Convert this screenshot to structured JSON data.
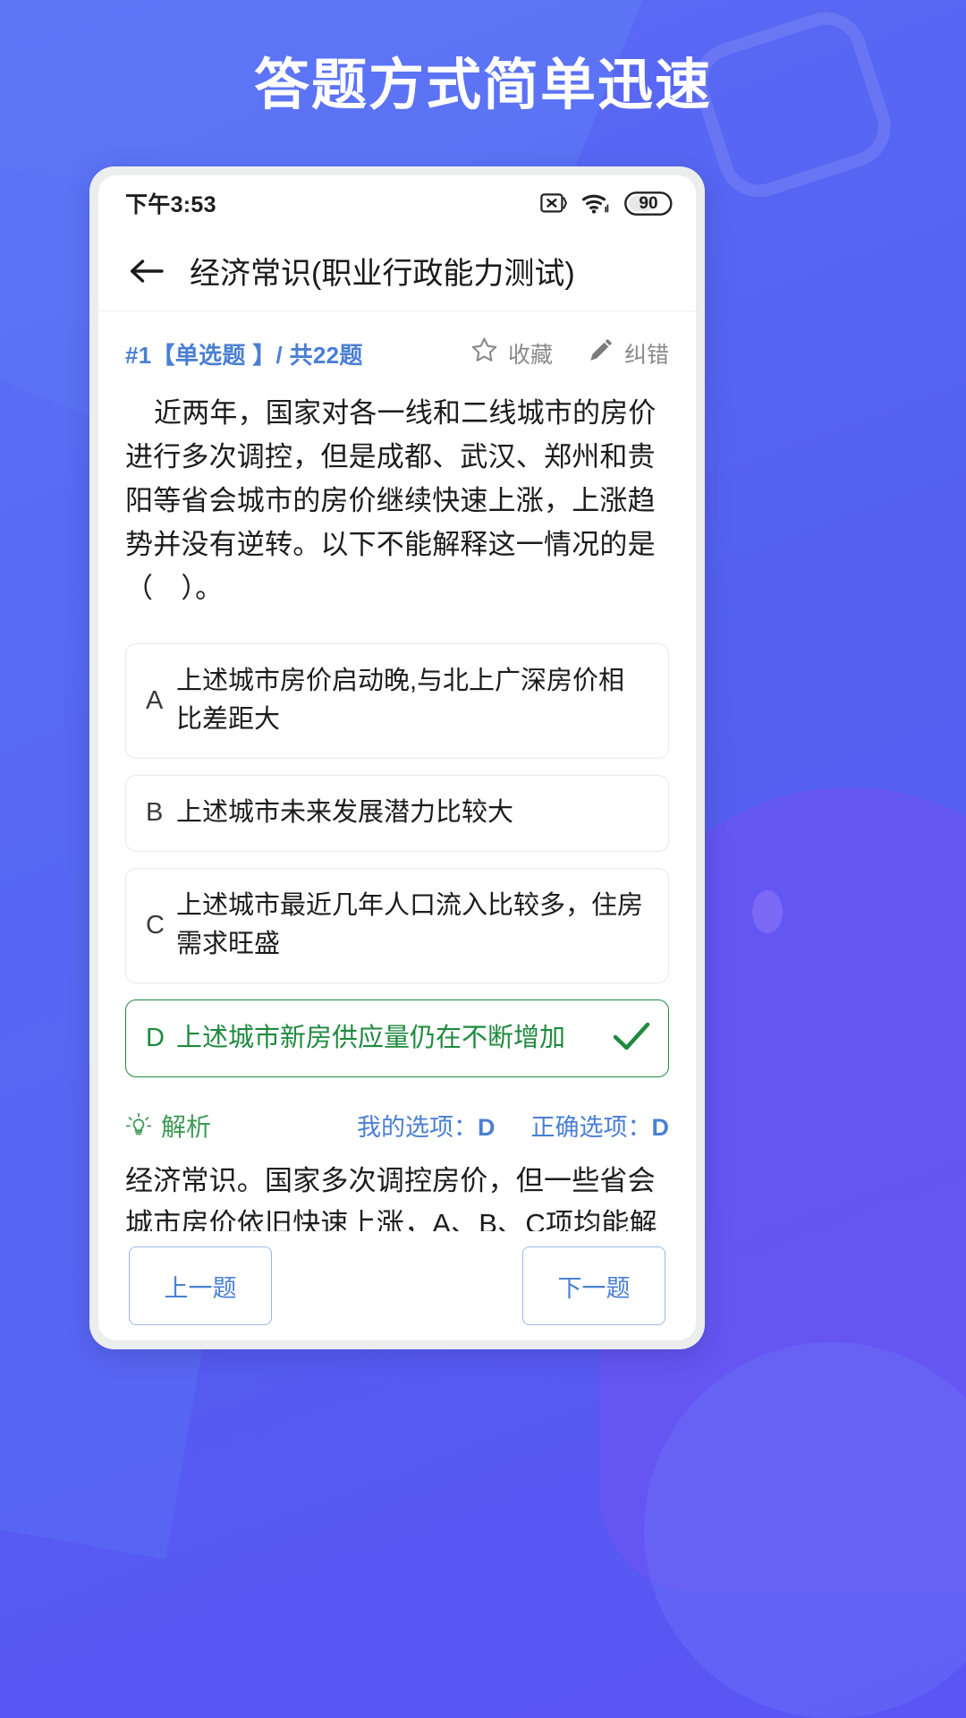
{
  "banner": {
    "headline": "答题方式简单迅速"
  },
  "status_bar": {
    "time": "下午3:53",
    "sim_icon": "sim-card-off-icon",
    "wifi_icon": "wifi-icon",
    "battery_level": "90"
  },
  "app_bar": {
    "back_icon": "back-arrow-icon",
    "title": "经济常识(职业行政能力测试)"
  },
  "question_meta": {
    "index_label": "#1【单选题 】/ 共22题",
    "favorite": {
      "icon": "star-icon",
      "label": "收藏"
    },
    "report": {
      "icon": "pencil-icon",
      "label": "纠错"
    }
  },
  "question": {
    "text": "近两年，国家对各一线和二线城市的房价进行多次调控，但是成都、武汉、郑州和贵阳等省会城市的房价继续快速上涨，上涨趋势并没有逆转。以下不能解释这一情况的是（　）。"
  },
  "options": [
    {
      "letter": "A",
      "text": "上述城市房价启动晚,与北上广深房价相比差距大",
      "state": "normal"
    },
    {
      "letter": "B",
      "text": "上述城市未来发展潜力比较大",
      "state": "normal"
    },
    {
      "letter": "C",
      "text": "上述城市最近几年人口流入比较多，住房需求旺盛",
      "state": "normal"
    },
    {
      "letter": "D",
      "text": "上述城市新房供应量仍在不断增加",
      "state": "correct"
    }
  ],
  "analysis": {
    "icon": "lightbulb-icon",
    "label": "解析",
    "my_answer_label": "我的选项：",
    "my_answer": "D",
    "correct_answer_label": "正确选项：",
    "correct_answer": "D",
    "body": "经济常识。国家多次调控房价，但一些省会城市房价依旧快速上涨，A、B、C项均能解释该现象；D项，在现代市场经济学中，价格是由供给与需求之间的互相影响、平衡产生的，若题干中的省会城市供应量不断增加，房屋需求量会减"
  },
  "bottom_nav": {
    "prev_label": "上一题",
    "next_label": "下一题"
  },
  "colors": {
    "brand_blue": "#5360f0",
    "link_blue": "#4a7fd4",
    "correct_green": "#1f8a3f",
    "analysis_green": "#3d9a55",
    "muted_gray": "#8a8a8a"
  }
}
